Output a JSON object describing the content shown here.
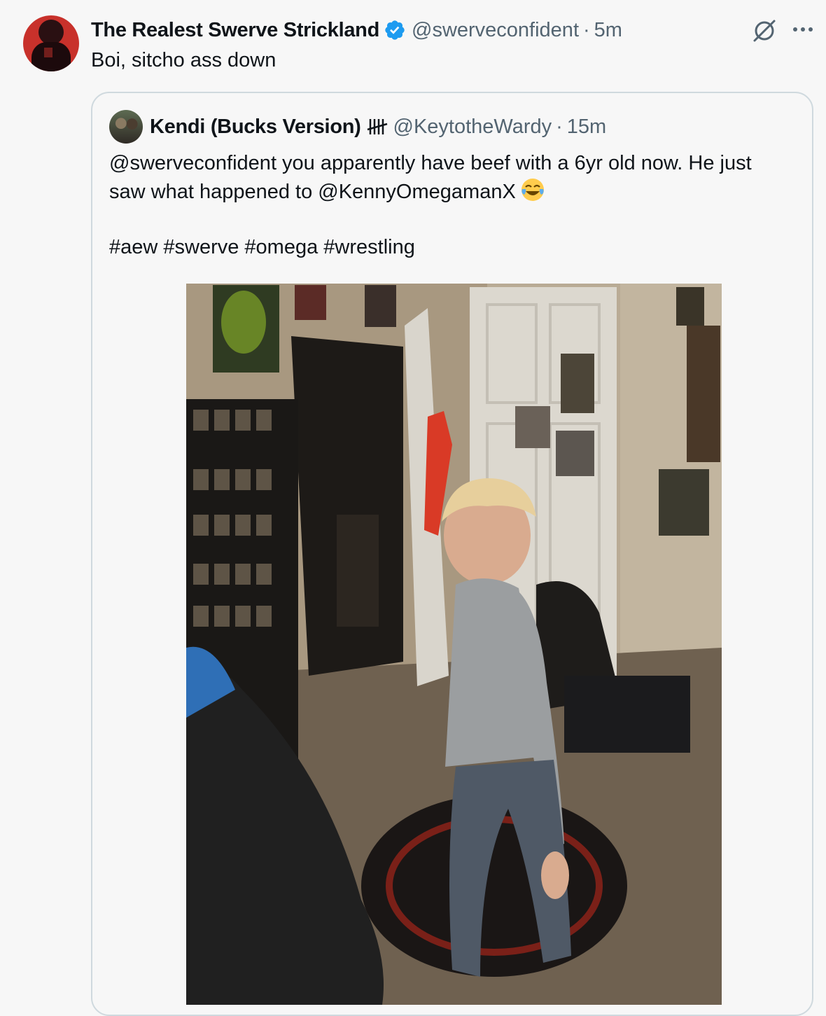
{
  "tweet": {
    "author_name": "The Realest Swerve Strickland",
    "handle": "@swerveconfident",
    "separator": "·",
    "time": "5m",
    "text": "Boi, sitcho ass down",
    "icons": {
      "verified": "verified-badge-icon",
      "grok": "grok-icon",
      "more": "more-icon"
    },
    "colors": {
      "verified": "#1d9bf0",
      "secondary_text": "#536471"
    }
  },
  "quoted_tweet": {
    "author_name": "Kendi (Bucks Version)",
    "name_glyph": "tally-marks-icon",
    "handle": "@KeytotheWardy",
    "separator": "·",
    "time": "15m",
    "text_line1": "@swerveconfident you apparently have beef with a 6yr old now. He just",
    "text_line2": "saw what happened to @KennyOmegamanX",
    "emoji": "face-with-tears-of-joy",
    "hashtags": "#aew #swerve #omega #wrestling",
    "media": "photo"
  }
}
